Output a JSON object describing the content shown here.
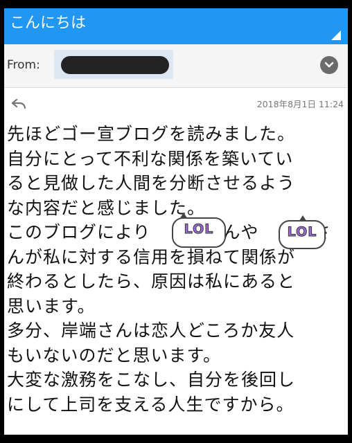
{
  "window": {
    "title": "こんにちは"
  },
  "header": {
    "from_label": "From:"
  },
  "message": {
    "date": "2018年8月1日 11:24",
    "lines": [
      "先ほどゴー宣ブログを読みました。",
      "自分にとって不利な関係を築いてい",
      "ると見做した人間を分断させるよう",
      "な内容だと感じました。",
      "このブログにより　　　さんや　　　さ",
      "んが私に対する信用を損ねて関係が",
      "終わるとしたら、原因は私にあると",
      "思います。",
      "多分、岸端さんは恋人どころか友人",
      "もいないのだと思います。",
      "大変な激務をこなし、自分を後回し",
      "にして上司を支える人生ですから。"
    ]
  },
  "stickers": [
    {
      "text": "LOL"
    },
    {
      "text": "LOL"
    }
  ],
  "icons": {
    "reply": "reply-arrow-icon",
    "expand": "chevron-down-icon",
    "corner": "signal-corner-icon"
  }
}
